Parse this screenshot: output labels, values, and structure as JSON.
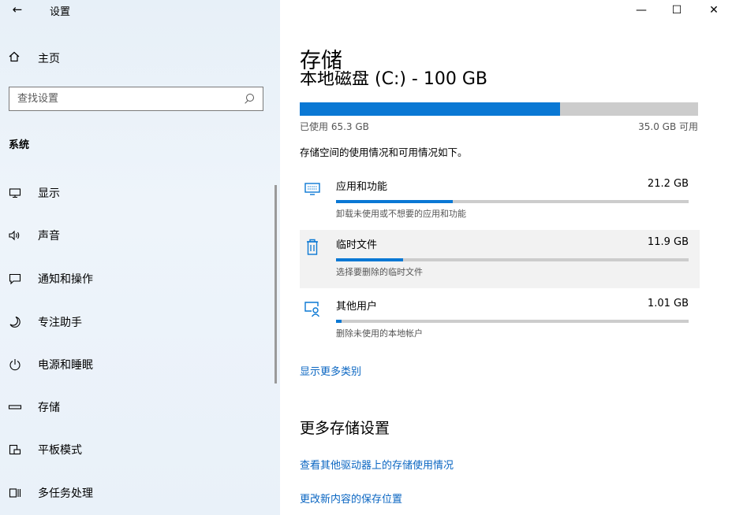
{
  "window": {
    "app_title": "设置",
    "back_glyph": "←",
    "controls": {
      "minimize": "—",
      "maximize": "☐",
      "close": "✕"
    }
  },
  "sidebar": {
    "home_label": "主页",
    "search_placeholder": "查找设置",
    "section_title": "系统",
    "items": [
      {
        "label": "显示",
        "icon": "monitor-icon",
        "glyph": "🖵"
      },
      {
        "label": "声音",
        "icon": "speaker-icon",
        "glyph": "🔈"
      },
      {
        "label": "通知和操作",
        "icon": "notification-icon",
        "glyph": "🗨"
      },
      {
        "label": "专注助手",
        "icon": "moon-icon",
        "glyph": "☽"
      },
      {
        "label": "电源和睡眠",
        "icon": "power-icon",
        "glyph": "⏻"
      },
      {
        "label": "存储",
        "icon": "storage-icon",
        "glyph": "▭"
      },
      {
        "label": "平板模式",
        "icon": "tablet-mode-icon",
        "glyph": "⧉"
      },
      {
        "label": "多任务处理",
        "icon": "multitasking-icon",
        "glyph": "⧈"
      }
    ]
  },
  "main": {
    "page_title": "存储",
    "disk_title": "本地磁盘 (C:) - 100 GB",
    "used": "已使用 65.3 GB",
    "free": "35.0 GB 可用",
    "used_fraction": 0.653,
    "description": "存储空间的使用情况和可用情况如下。",
    "categories": [
      {
        "name": "应用和功能",
        "size": "21.2 GB",
        "sub": "卸载未使用或不想要的应用和功能",
        "icon": "apps-icon",
        "fraction": 0.33
      },
      {
        "name": "临时文件",
        "size": "11.9 GB",
        "sub": "选择要删除的临时文件",
        "icon": "trash-icon",
        "fraction": 0.19
      },
      {
        "name": "其他用户",
        "size": "1.01 GB",
        "sub": "删除未使用的本地帐户",
        "icon": "other-users-icon",
        "fraction": 0.015
      }
    ],
    "show_more": "显示更多类别",
    "more_settings_title": "更多存储设置",
    "links": [
      "查看其他驱动器上的存储使用情况",
      "更改新内容的保存位置"
    ]
  },
  "colors": {
    "accent": "#0a78d4",
    "link": "#0a66c2",
    "bar_bg": "#cccccc"
  }
}
